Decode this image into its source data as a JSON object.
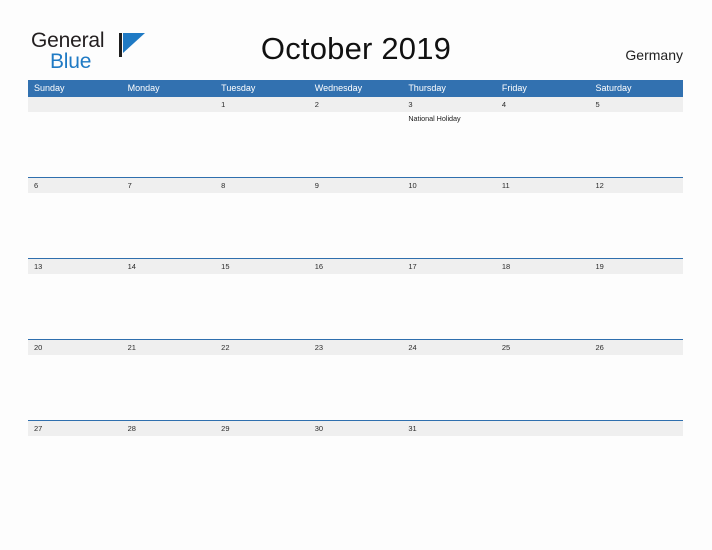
{
  "brand": {
    "name_part1": "General",
    "name_part2": "Blue",
    "mark_icon": "blue-triangle-flag-icon",
    "colors": {
      "dark": "#231f20",
      "blue": "#1f7ac4"
    }
  },
  "header": {
    "title": "October 2019",
    "region": "Germany"
  },
  "calendar": {
    "month": "October",
    "year": "2019",
    "accent_color": "#3271b0",
    "band_color": "#efefef",
    "weekday_headers": [
      "Sunday",
      "Monday",
      "Tuesday",
      "Wednesday",
      "Thursday",
      "Friday",
      "Saturday"
    ],
    "weeks": [
      {
        "days": [
          {
            "date": "",
            "event": ""
          },
          {
            "date": "",
            "event": ""
          },
          {
            "date": "1",
            "event": ""
          },
          {
            "date": "2",
            "event": ""
          },
          {
            "date": "3",
            "event": "National Holiday"
          },
          {
            "date": "4",
            "event": ""
          },
          {
            "date": "5",
            "event": ""
          }
        ]
      },
      {
        "days": [
          {
            "date": "6",
            "event": ""
          },
          {
            "date": "7",
            "event": ""
          },
          {
            "date": "8",
            "event": ""
          },
          {
            "date": "9",
            "event": ""
          },
          {
            "date": "10",
            "event": ""
          },
          {
            "date": "11",
            "event": ""
          },
          {
            "date": "12",
            "event": ""
          }
        ]
      },
      {
        "days": [
          {
            "date": "13",
            "event": ""
          },
          {
            "date": "14",
            "event": ""
          },
          {
            "date": "15",
            "event": ""
          },
          {
            "date": "16",
            "event": ""
          },
          {
            "date": "17",
            "event": ""
          },
          {
            "date": "18",
            "event": ""
          },
          {
            "date": "19",
            "event": ""
          }
        ]
      },
      {
        "days": [
          {
            "date": "20",
            "event": ""
          },
          {
            "date": "21",
            "event": ""
          },
          {
            "date": "22",
            "event": ""
          },
          {
            "date": "23",
            "event": ""
          },
          {
            "date": "24",
            "event": ""
          },
          {
            "date": "25",
            "event": ""
          },
          {
            "date": "26",
            "event": ""
          }
        ]
      },
      {
        "days": [
          {
            "date": "27",
            "event": ""
          },
          {
            "date": "28",
            "event": ""
          },
          {
            "date": "29",
            "event": ""
          },
          {
            "date": "30",
            "event": ""
          },
          {
            "date": "31",
            "event": ""
          },
          {
            "date": "",
            "event": ""
          },
          {
            "date": "",
            "event": ""
          }
        ]
      }
    ]
  }
}
